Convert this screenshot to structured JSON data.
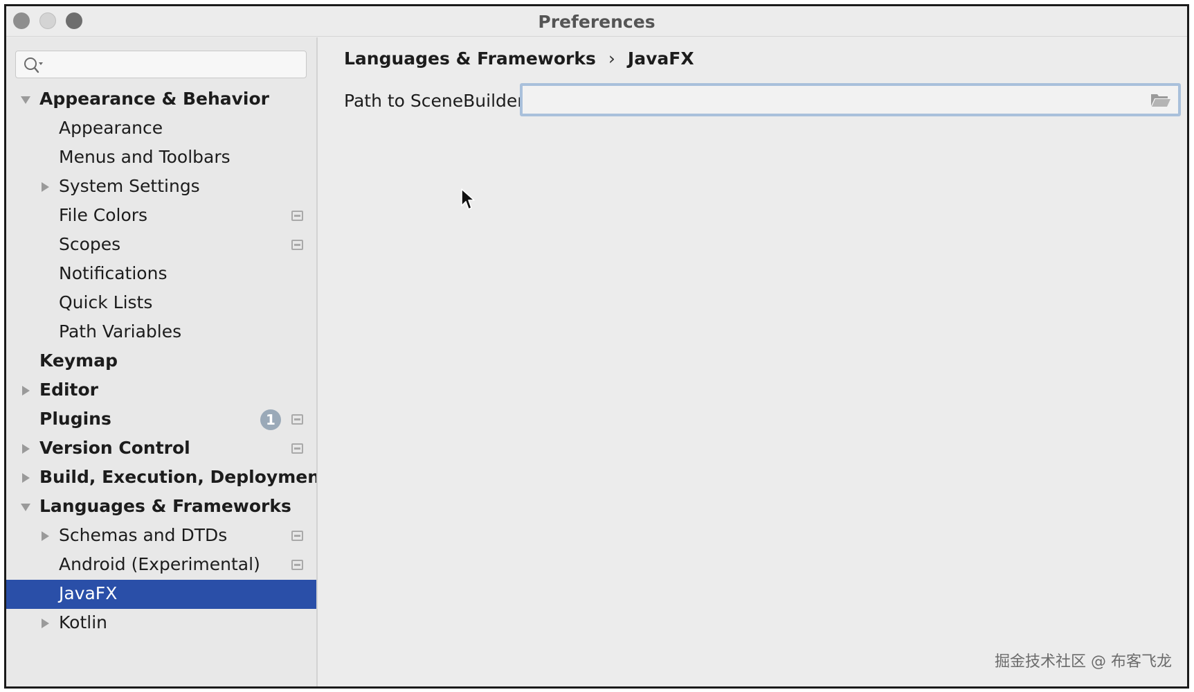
{
  "window": {
    "title": "Preferences"
  },
  "search": {
    "placeholder": "",
    "value": ""
  },
  "sidebar": {
    "items": [
      {
        "label": "Appearance & Behavior",
        "bold": true,
        "expander": "expanded"
      },
      {
        "label": "Appearance"
      },
      {
        "label": "Menus and Toolbars"
      },
      {
        "label": "System Settings",
        "expander": "collapsed"
      },
      {
        "label": "File Colors",
        "project_icon": true
      },
      {
        "label": "Scopes",
        "project_icon": true
      },
      {
        "label": "Notifications"
      },
      {
        "label": "Quick Lists"
      },
      {
        "label": "Path Variables"
      },
      {
        "label": "Keymap",
        "bold": true
      },
      {
        "label": "Editor",
        "bold": true,
        "expander": "collapsed"
      },
      {
        "label": "Plugins",
        "bold": true,
        "badge": "1",
        "project_icon": true
      },
      {
        "label": "Version Control",
        "bold": true,
        "expander": "collapsed",
        "project_icon": true
      },
      {
        "label": "Build, Execution, Deployment",
        "bold": true,
        "expander": "collapsed"
      },
      {
        "label": "Languages & Frameworks",
        "bold": true,
        "expander": "expanded"
      },
      {
        "label": "Schemas and DTDs",
        "expander": "collapsed",
        "project_icon": true
      },
      {
        "label": "Android (Experimental)",
        "project_icon": true
      },
      {
        "label": "JavaFX",
        "selected": true
      },
      {
        "label": "Kotlin",
        "expander": "collapsed"
      }
    ]
  },
  "content": {
    "breadcrumb": {
      "parent": "Languages & Frameworks",
      "separator": "›",
      "current": "JavaFX"
    },
    "scenebuilder": {
      "label": "Path to SceneBuilder:",
      "value": "",
      "browse_icon": "folder-open-icon"
    }
  },
  "watermark": {
    "text": "掘金技术社区 @ 布客飞龙"
  },
  "colors": {
    "selection": "#2a4fa8",
    "sidebar_bg": "#e8e8e8",
    "content_bg": "#ececec",
    "focus_border": "#a9c0db",
    "badge_bg": "#9aa9b8"
  }
}
